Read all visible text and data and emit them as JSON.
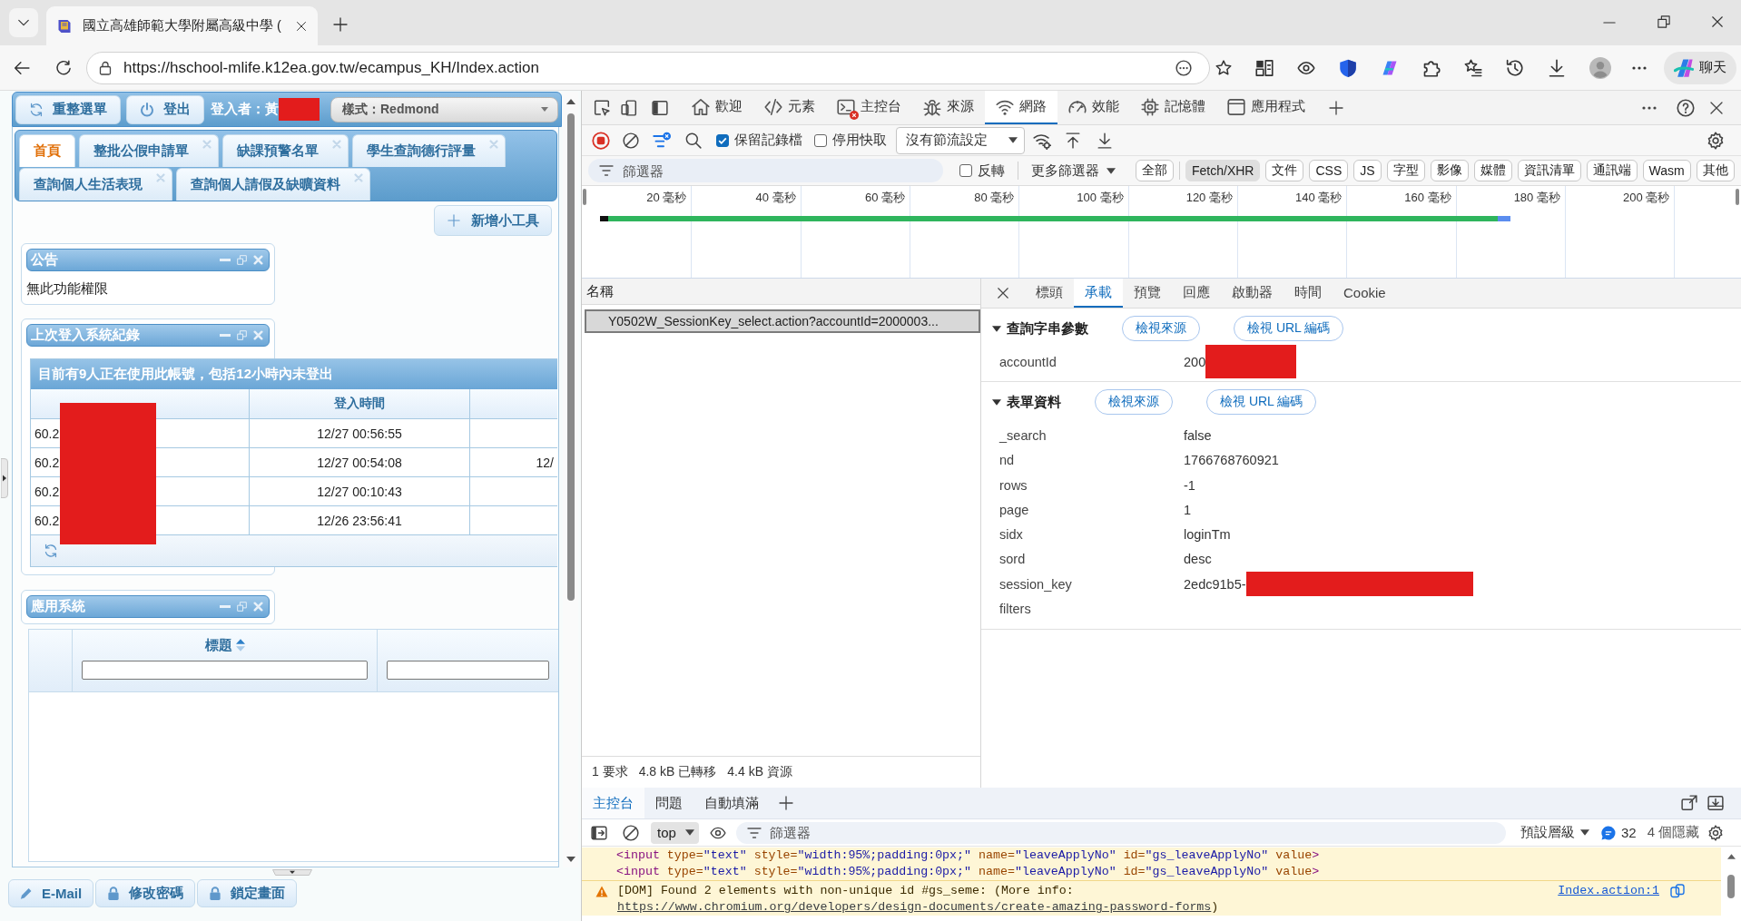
{
  "browser": {
    "tabs": [
      {
        "title": "國立高雄師範大學附屬高級中學 (",
        "selected": true
      }
    ],
    "url": "https://hschool-mlife.k12ea.gov.tw/ecampus_KH/Index.action",
    "chat_label": "聊天"
  },
  "app": {
    "toolbar_buttons": [
      "重整選單",
      "登出"
    ],
    "user": {
      "label": "登入者：黃",
      "redacted": true
    },
    "theme_select": "樣式：Redmond",
    "tab_rows": [
      [
        {
          "label": "首頁",
          "selected": true,
          "closable": false
        },
        {
          "label": "整批公假申請單",
          "selected": false,
          "closable": true
        },
        {
          "label": "缺課預警名單",
          "selected": false,
          "closable": true
        },
        {
          "label": "學生查詢德行評量",
          "selected": false,
          "closable": true
        }
      ],
      [
        {
          "label": "查詢個人生活表現",
          "selected": false,
          "closable": true
        },
        {
          "label": "查詢個人請假及缺曠資料",
          "selected": false,
          "closable": true
        }
      ]
    ],
    "add_widget_button": "新增小工具",
    "widgets": [
      {
        "kind": "message",
        "title": "公告",
        "message": "無此功能權限"
      },
      {
        "kind": "login_log",
        "title": "上次登入系統紀錄",
        "caption": "目前有9人正在使用此帳號，包括12小時內未登出",
        "column_headings": {
          "column_2": "登入時間"
        },
        "rows": [
          {
            "column_1": "60.2",
            "column_2": "12/27 00:56:55"
          },
          {
            "column_1": "60.2",
            "column_2": "12/27 00:54:08",
            "column_3": "12/"
          },
          {
            "column_1": "60.2",
            "column_2": "12/27 00:10:43"
          },
          {
            "column_1": "60.2",
            "column_2": "12/26 23:56:41"
          }
        ],
        "ip_redacted": true
      },
      {
        "kind": "grid",
        "title": "應用系統",
        "columns": [
          {
            "kind": "rownum",
            "sortable": false
          },
          {
            "kind": "filter",
            "heading": "標題",
            "sortable": true
          },
          {
            "kind": "filter",
            "sortable": false
          }
        ]
      }
    ],
    "bottom_buttons": [
      "E-Mail",
      "修改密碼",
      "鎖定畫面"
    ]
  },
  "devtools": {
    "tabs": [
      {
        "label": "歡迎",
        "selected": false,
        "error": false
      },
      {
        "label": "元素",
        "selected": false,
        "error": false
      },
      {
        "label": "主控台",
        "selected": false,
        "error": true
      },
      {
        "label": "來源",
        "selected": false,
        "error": false
      },
      {
        "label": "網路",
        "selected": true,
        "error": false
      },
      {
        "label": "效能",
        "selected": false,
        "error": false
      },
      {
        "label": "記憶體",
        "selected": false,
        "error": false
      },
      {
        "label": "應用程式",
        "selected": false,
        "error": false
      }
    ],
    "network_toolbar": {
      "recording": true,
      "preserve_log": {
        "label": "保留記錄檔",
        "checked": true
      },
      "disable_cache": {
        "label": "停用快取",
        "checked": false
      },
      "throttling": "沒有節流設定"
    },
    "filter_bar": {
      "placeholder": "篩選器",
      "invert": {
        "label": "反轉",
        "checked": false
      },
      "more_filters": "更多篩選器",
      "types": [
        {
          "label": "全部",
          "selected": false
        },
        {
          "label": "Fetch/XHR",
          "selected": true
        },
        {
          "label": "文件",
          "selected": false
        },
        {
          "label": "CSS",
          "selected": false
        },
        {
          "label": "JS",
          "selected": false
        },
        {
          "label": "字型",
          "selected": false
        },
        {
          "label": "影像",
          "selected": false
        },
        {
          "label": "媒體",
          "selected": false
        },
        {
          "label": "資訊清單",
          "selected": false
        },
        {
          "label": "通訊端",
          "selected": false
        },
        {
          "label": "Wasm",
          "selected": false
        },
        {
          "label": "其他",
          "selected": false
        }
      ]
    },
    "timeline": {
      "ticks": [
        "20 毫秒",
        "40 毫秒",
        "60 毫秒",
        "80 毫秒",
        "100 毫秒",
        "120 毫秒",
        "140 毫秒",
        "160 毫秒",
        "180 毫秒",
        "200 毫秒"
      ]
    },
    "requests": {
      "column": "名稱",
      "rows": [
        {
          "name": "Y0502W_SessionKey_select.action?accountId=2000003...",
          "selected": true
        }
      ],
      "summary": [
        "1 要求",
        "4.8 kB 已轉移",
        "4.4 kB 資源"
      ]
    },
    "details": {
      "tabs": [
        {
          "label": "標頭",
          "selected": false
        },
        {
          "label": "承載",
          "selected": true
        },
        {
          "label": "預覽",
          "selected": false
        },
        {
          "label": "回應",
          "selected": false
        },
        {
          "label": "啟動器",
          "selected": false
        },
        {
          "label": "時間",
          "selected": false
        },
        {
          "label": "Cookie",
          "selected": false
        }
      ],
      "sections": [
        {
          "title": "查詢字串參數",
          "expanded": true,
          "buttons": [
            "檢視來源",
            "檢視 URL 編碼"
          ],
          "params": [
            {
              "key": "accountId",
              "value": "200",
              "redacted": true
            }
          ]
        },
        {
          "title": "表單資料",
          "expanded": true,
          "buttons": [
            "檢視來源",
            "檢視 URL 編碼"
          ],
          "params": [
            {
              "key": "_search",
              "value": "false",
              "redacted": false
            },
            {
              "key": "nd",
              "value": "1766768760921",
              "redacted": false
            },
            {
              "key": "rows",
              "value": "-1",
              "redacted": false
            },
            {
              "key": "page",
              "value": "1",
              "redacted": false
            },
            {
              "key": "sidx",
              "value": "loginTm",
              "redacted": false
            },
            {
              "key": "sord",
              "value": "desc",
              "redacted": false
            },
            {
              "key": "session_key",
              "value": "2edc91b5-",
              "redacted": true
            },
            {
              "key": "filters",
              "redacted": false
            }
          ]
        }
      ]
    },
    "drawer": {
      "tabs": [
        {
          "label": "主控台",
          "selected": true
        },
        {
          "label": "問題",
          "selected": false
        },
        {
          "label": "自動填滿",
          "selected": false
        }
      ],
      "context": "top",
      "filter_placeholder": "篩選器",
      "log_levels": "預設層級",
      "message_count": "32",
      "hidden_count": "4 個隱藏",
      "messages": [
        {
          "kind": "element",
          "segments": [
            {
              "kind": "tag",
              "text": "<input"
            },
            {
              "kind": "attr",
              "text": " type="
            },
            {
              "kind": "value",
              "text": "\"text\""
            },
            {
              "kind": "attr",
              "text": " style="
            },
            {
              "kind": "value",
              "text": "\"width:95%;padding:0px;\""
            },
            {
              "kind": "attr",
              "text": " name="
            },
            {
              "kind": "value",
              "text": "\"leaveApplyNo\""
            },
            {
              "kind": "attr",
              "text": " id="
            },
            {
              "kind": "value",
              "text": "\"gs_leaveApplyNo\""
            },
            {
              "kind": "attr",
              "text": " value"
            },
            {
              "kind": "tag",
              "text": ">"
            }
          ]
        },
        {
          "kind": "element",
          "segments": [
            {
              "kind": "tag",
              "text": "<input"
            },
            {
              "kind": "attr",
              "text": " type="
            },
            {
              "kind": "value",
              "text": "\"text\""
            },
            {
              "kind": "attr",
              "text": " style="
            },
            {
              "kind": "value",
              "text": "\"width:95%;padding:0px;\""
            },
            {
              "kind": "attr",
              "text": " name="
            },
            {
              "kind": "value",
              "text": "\"leaveApplyNo\""
            },
            {
              "kind": "attr",
              "text": " id="
            },
            {
              "kind": "value",
              "text": "\"gs_leaveApplyNo\""
            },
            {
              "kind": "attr",
              "text": " value"
            },
            {
              "kind": "tag",
              "text": ">"
            }
          ]
        },
        {
          "kind": "warning",
          "text": "[DOM] Found 2 elements with non-unique id #gs_seme: (More info:",
          "link": "https://www.chromium.org/developers/design-documents/create-amazing-password-forms",
          "tail": ")",
          "source": "Index.action:1"
        }
      ]
    }
  }
}
